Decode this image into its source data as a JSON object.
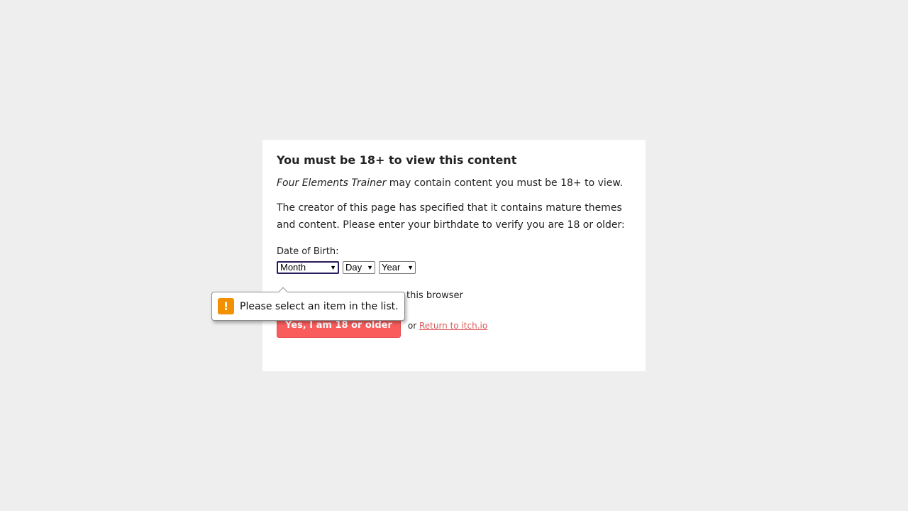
{
  "dialog": {
    "title": "You must be 18+ to view this content",
    "game_name": "Four Elements Trainer",
    "intro_rest": " may contain content you must be 18+ to view.",
    "description": "The creator of this page has specified that it contains mature themes and content. Please enter your birthdate to verify you are 18 or older:",
    "dob_label": "Date of Birth:",
    "month_select": "Month",
    "day_select": "Day",
    "year_select": "Year",
    "remember_visible_text": "this browser",
    "confirm_button": "Yes, I am 18 or older",
    "or_text": "or",
    "return_link": "Return to itch.io"
  },
  "validation_tooltip": {
    "icon": "warning-icon",
    "icon_glyph": "!",
    "message": "Please select an item in the list."
  },
  "colors": {
    "background": "#eeeeee",
    "accent": "#fa5c5c",
    "link": "#da5a5a",
    "warning": "#f29000"
  }
}
